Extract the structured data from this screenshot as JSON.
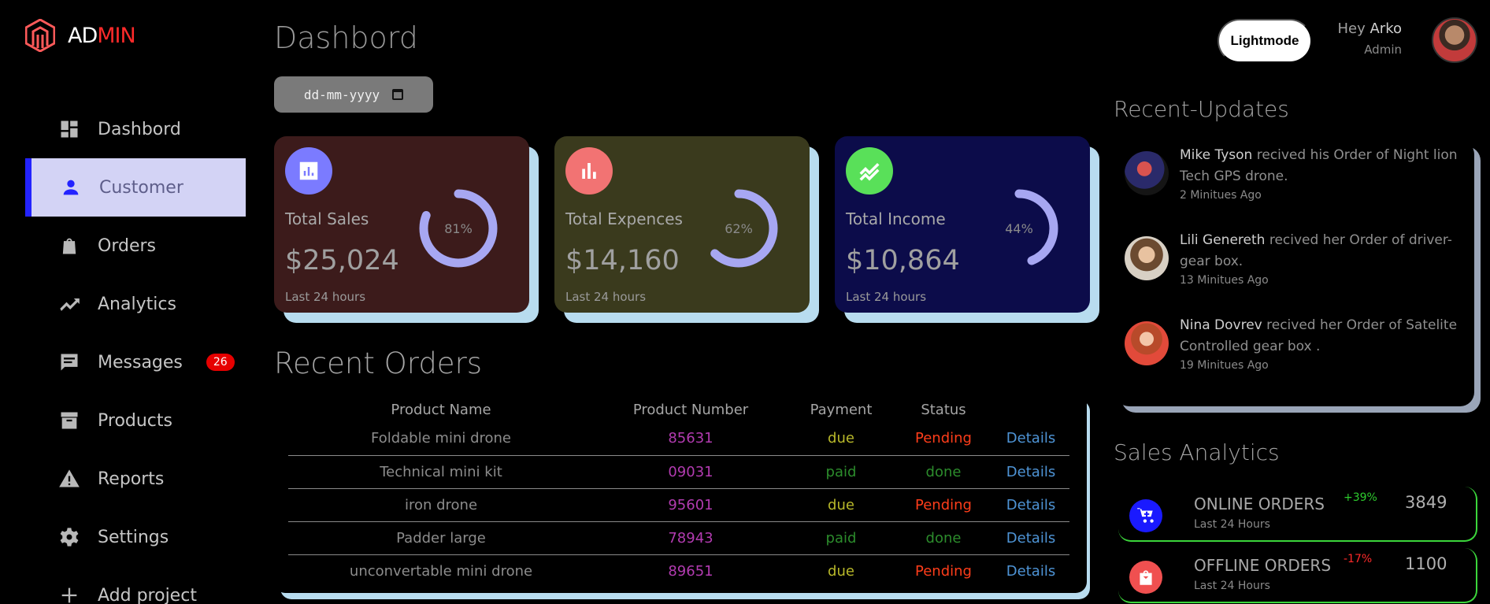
{
  "logo": {
    "text_a": "AD",
    "text_b": "MIN"
  },
  "sidebar": {
    "items": [
      {
        "label": "Dashbord",
        "icon": "grid-icon"
      },
      {
        "label": "Customer",
        "icon": "person-icon"
      },
      {
        "label": "Orders",
        "icon": "bag-icon"
      },
      {
        "label": "Analytics",
        "icon": "trending-icon"
      },
      {
        "label": "Messages",
        "icon": "message-icon",
        "badge": "26"
      },
      {
        "label": "Products",
        "icon": "box-icon"
      },
      {
        "label": "Reports",
        "icon": "warning-icon"
      },
      {
        "label": "Settings",
        "icon": "gear-icon"
      },
      {
        "label": "Add project",
        "icon": "plus-icon"
      }
    ],
    "active_index": 1
  },
  "header": {
    "title": "Dashbord",
    "date_placeholder": "dd-mm-yyyy",
    "mode_button": "Lightmode",
    "greeting": "Hey",
    "user_name": "Arko",
    "user_role": "Admin"
  },
  "cards": [
    {
      "label": "Total Sales",
      "value": "$25,024",
      "percent": "81%",
      "percent_value": 81,
      "footer": "Last 24 hours",
      "chip_color": "#7b7bff"
    },
    {
      "label": "Total Expences",
      "value": "$14,160",
      "percent": "62%",
      "percent_value": 62,
      "footer": "Last 24 hours",
      "chip_color": "#f27373"
    },
    {
      "label": "Total Income",
      "value": "$10,864",
      "percent": "44%",
      "percent_value": 44,
      "footer": "Last 24 hours",
      "chip_color": "#59e059"
    }
  ],
  "recent_orders": {
    "title": "Recent Orders",
    "columns": [
      "Product Name",
      "Product Number",
      "Payment",
      "Status",
      ""
    ],
    "rows": [
      {
        "name": "Foldable mini drone",
        "number": "85631",
        "payment": "due",
        "status": "Pending",
        "link": "Details"
      },
      {
        "name": "Technical mini kit",
        "number": "09031",
        "payment": "paid",
        "status": "done",
        "link": "Details"
      },
      {
        "name": "iron drone",
        "number": "95601",
        "payment": "due",
        "status": "Pending",
        "link": "Details"
      },
      {
        "name": "Padder large",
        "number": "78943",
        "payment": "paid",
        "status": "done",
        "link": "Details"
      },
      {
        "name": "unconvertable mini drone",
        "number": "89651",
        "payment": "due",
        "status": "Pending",
        "link": "Details"
      }
    ]
  },
  "recent_updates": {
    "title": "Recent-Updates",
    "items": [
      {
        "name": "Mike Tyson",
        "text": " recived his Order of Night lion Tech GPS drone.",
        "ago": "2 Minitues Ago"
      },
      {
        "name": "Lili Genereth",
        "text": " recived her Order of driver-gear box.",
        "ago": "13 Minitues Ago"
      },
      {
        "name": "Nina Dovrev",
        "text": " recived her Order of Satelite Controlled gear box .",
        "ago": "19 Minitues Ago"
      }
    ]
  },
  "sales_analytics": {
    "title": "Sales Analytics",
    "items": [
      {
        "name": "ONLINE ORDERS",
        "footer": "Last 24 Hours",
        "change": "+39%",
        "change_color": "#2ecc2e",
        "value": "3849",
        "icon": "cart-icon",
        "icon_bg": "#1a1aff"
      },
      {
        "name": "OFFLINE ORDERS",
        "footer": "Last 24 Hours",
        "change": "-17%",
        "change_color": "#ff2a2a",
        "value": "1100",
        "icon": "shopping-bag-icon",
        "icon_bg": "#f05050"
      }
    ]
  }
}
